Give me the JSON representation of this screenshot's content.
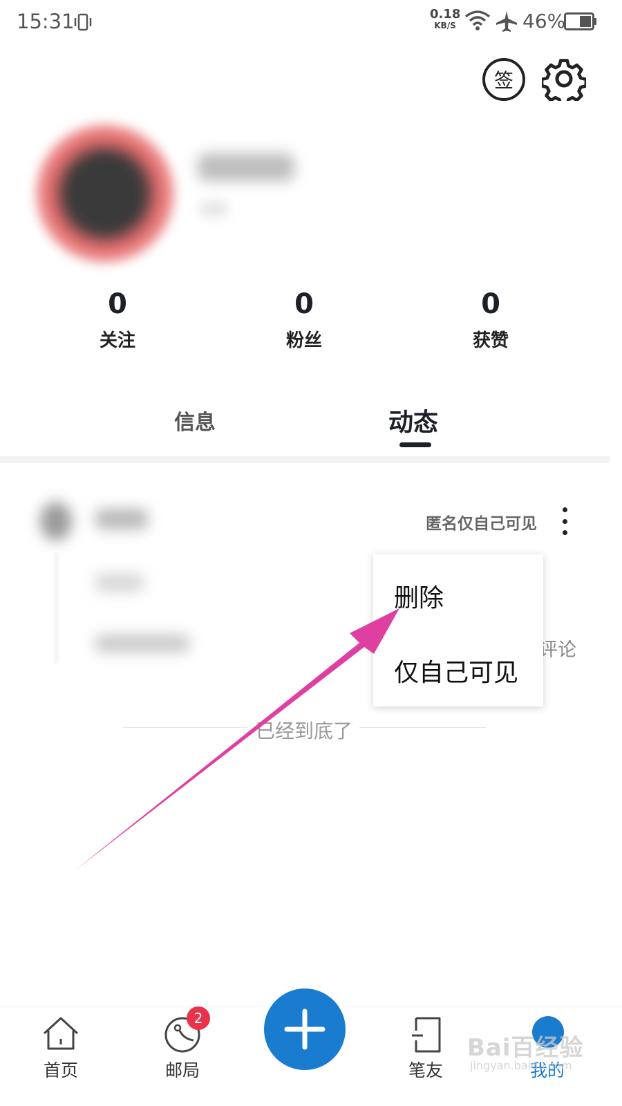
{
  "status_bar": {
    "time": "15:31",
    "net_speed_value": "0.18",
    "net_speed_unit": "KB/S",
    "battery": "46%"
  },
  "header": {
    "sign_label": "签"
  },
  "stats": [
    {
      "value": "0",
      "label": "关注"
    },
    {
      "value": "0",
      "label": "粉丝"
    },
    {
      "value": "0",
      "label": "获赞"
    }
  ],
  "tabs": [
    {
      "label": "信息",
      "active": false
    },
    {
      "label": "动态",
      "active": true
    }
  ],
  "feed": {
    "visibility_label": "匿名仅自己可见",
    "comment_label": "评论",
    "end_text": "已经到底了"
  },
  "popup_menu": {
    "items": [
      "删除",
      "仅自己可见"
    ]
  },
  "bottom_nav": {
    "items": [
      {
        "label": "首页",
        "icon": "home-icon"
      },
      {
        "label": "邮局",
        "icon": "post-icon"
      },
      {
        "label": "笔友",
        "icon": "penpal-icon"
      },
      {
        "label": "我的",
        "icon": "profile-icon"
      }
    ],
    "post_badge": "2"
  },
  "watermark": {
    "text": "Bai百经验",
    "sub": "jingyan.baidu.com"
  },
  "colors": {
    "accent": "#1a7ccf",
    "badge": "#e8334a",
    "annotation_arrow": "#de3fa1"
  }
}
